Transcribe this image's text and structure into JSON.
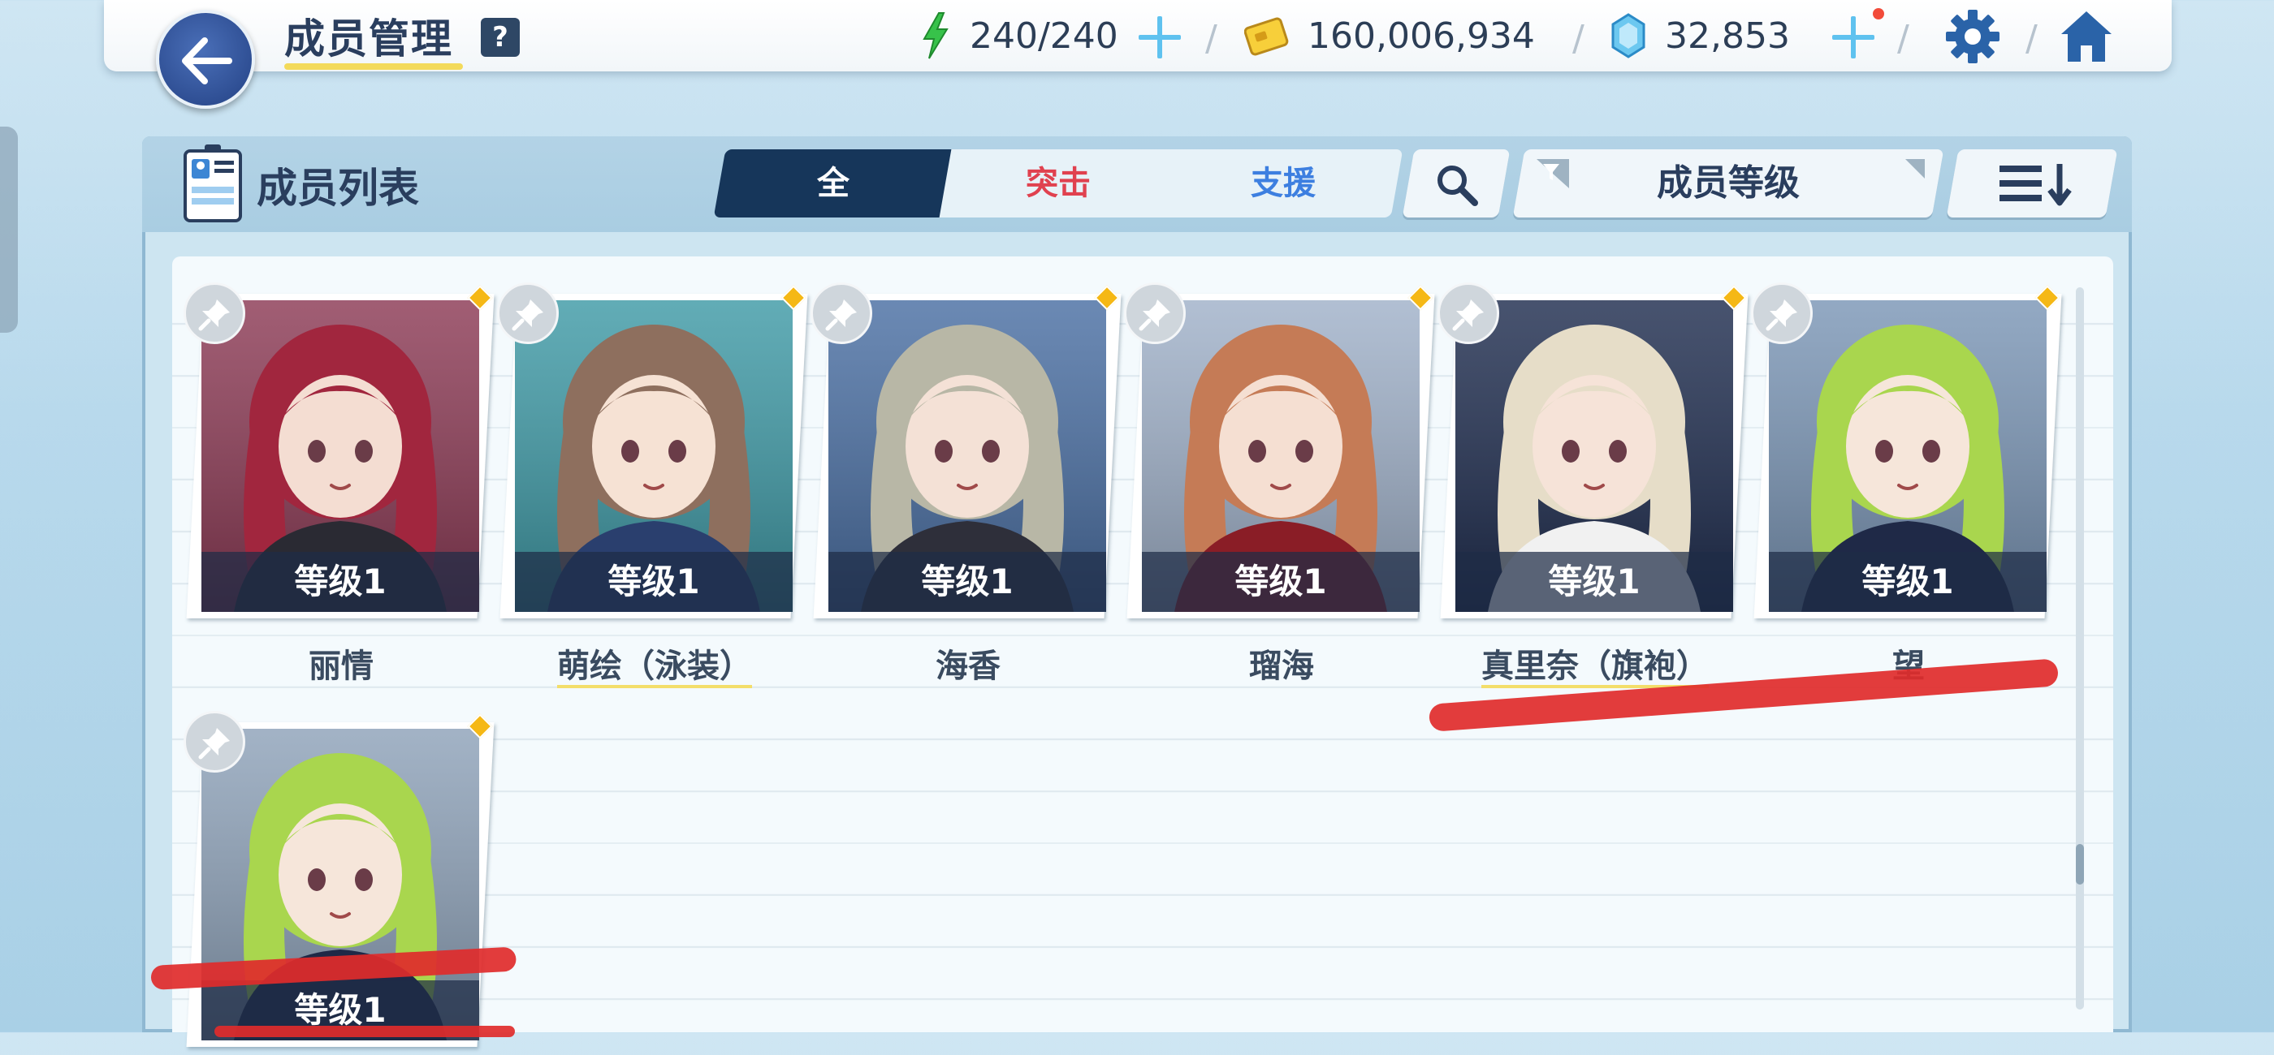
{
  "header": {
    "title": "成员管理",
    "help": "?",
    "stamina": "240/240",
    "credits": "160,006,934",
    "gems": "32,853"
  },
  "panel": {
    "title": "成员列表",
    "filters": [
      "全",
      "突击",
      "支援"
    ],
    "sort_label": "成员等级"
  },
  "members": [
    {
      "name": "丽情",
      "level": "等级1",
      "bg": "#8c3a55",
      "hair": "#a1263e",
      "skin": "#f4ddd2",
      "outfit": "#2a2a33"
    },
    {
      "name": "萌绘（泳装）",
      "level": "等级1",
      "bg": "#3f9aa6",
      "hair": "#8e6f5e",
      "skin": "#f6e2d4",
      "outfit": "#2a3f6e"
    },
    {
      "name": "海香",
      "level": "等级1",
      "bg": "#4a6fa3",
      "hair": "#b8b7a6",
      "skin": "#f4e1d6",
      "outfit": "#2e2f3a"
    },
    {
      "name": "瑠海",
      "level": "等级1",
      "bg": "#a0b1c9",
      "hair": "#c57b56",
      "skin": "#f5dfd2",
      "outfit": "#8a1d26"
    },
    {
      "name": "真里奈（旗袍）",
      "level": "等级1",
      "bg": "#1f2d4f",
      "hair": "#e6ddc8",
      "skin": "#f6e3d8",
      "outfit": "#f1f1f1"
    },
    {
      "name": "望",
      "level": "等级1",
      "bg": "#7b96b6",
      "hair": "#a9d64e",
      "skin": "#f6e6da",
      "outfit": "#1f2947"
    },
    {
      "name": "",
      "level": "等级1",
      "bg": "#8ea2b9",
      "hair": "#a9d64e",
      "skin": "#f6e6da",
      "outfit": "#1f2947"
    }
  ]
}
